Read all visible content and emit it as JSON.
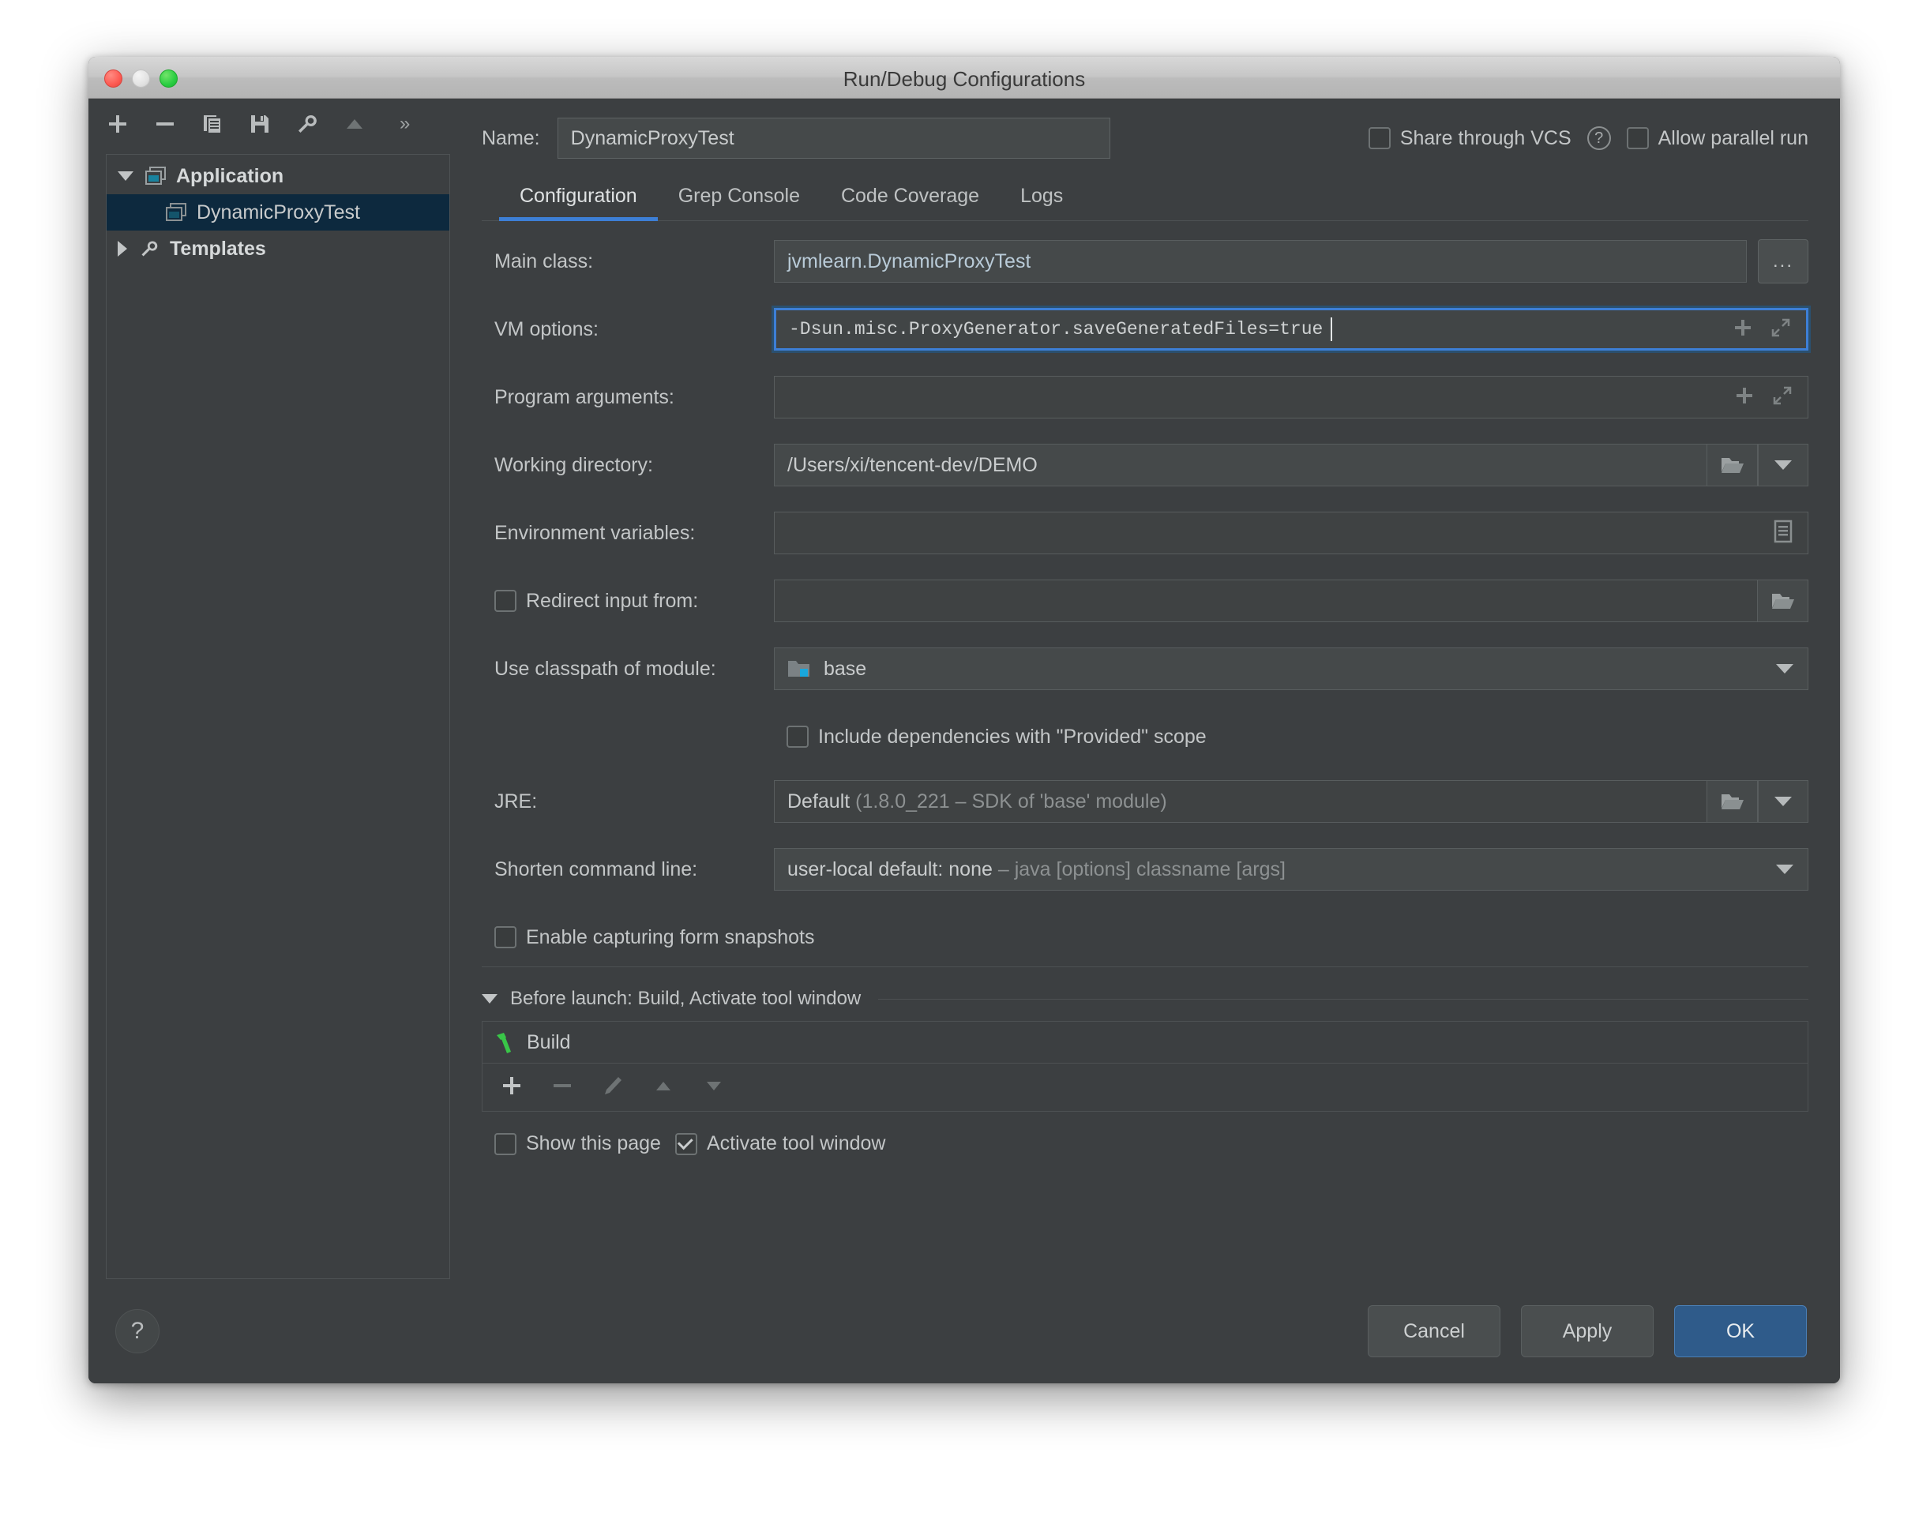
{
  "window": {
    "title": "Run/Debug Configurations"
  },
  "toolbar": {
    "icons": [
      "add-icon",
      "remove-icon",
      "copy-icon",
      "save-icon",
      "wrench-icon",
      "move-up-icon",
      "more-chevrons-icon"
    ]
  },
  "tree": {
    "nodes": [
      {
        "label": "Application",
        "icon": "application-icon",
        "expanded": true,
        "level": 0
      },
      {
        "label": "DynamicProxyTest",
        "icon": "application-icon",
        "selected": true,
        "level": 1
      },
      {
        "label": "Templates",
        "icon": "wrench-icon",
        "expanded": false,
        "level": 0
      }
    ]
  },
  "header": {
    "name_label": "Name:",
    "name_value": "DynamicProxyTest",
    "share_label": "Share through VCS",
    "share_checked": false,
    "allow_parallel_label": "Allow parallel run",
    "allow_parallel_checked": false,
    "help_glyph": "?"
  },
  "tabs": [
    {
      "label": "Configuration",
      "active": true
    },
    {
      "label": "Grep Console",
      "active": false
    },
    {
      "label": "Code Coverage",
      "active": false
    },
    {
      "label": "Logs",
      "active": false
    }
  ],
  "fields": {
    "main_class": {
      "label": "Main class:",
      "value": "jvmlearn.DynamicProxyTest",
      "browse_label": "..."
    },
    "vm_options": {
      "label": "VM options:",
      "value": "-Dsun.misc.ProxyGenerator.saveGeneratedFiles=true ",
      "focused": true
    },
    "program_arguments": {
      "label": "Program arguments:",
      "value": ""
    },
    "working_directory": {
      "label": "Working directory:",
      "value": "/Users/xi/tencent-dev/DEMO"
    },
    "environment_variables": {
      "label": "Environment variables:",
      "value": ""
    },
    "redirect_input": {
      "label": "Redirect input from:",
      "checked": false,
      "value": ""
    },
    "classpath_module": {
      "label": "Use classpath of module:",
      "value": "base"
    },
    "include_provided": {
      "label": "Include dependencies with \"Provided\" scope",
      "checked": false
    },
    "jre": {
      "label": "JRE:",
      "value": "Default",
      "value_detail": "(1.8.0_221 – SDK of 'base' module)"
    },
    "shorten_command_line": {
      "label": "Shorten command line:",
      "value": "user-local default: none",
      "value_detail": "– java [options] classname [args]"
    },
    "form_snapshots": {
      "label": "Enable capturing form snapshots",
      "checked": false
    }
  },
  "before_launch": {
    "header": "Before launch: Build, Activate tool window",
    "items": [
      {
        "label": "Build",
        "icon": "hammer-icon"
      }
    ],
    "toolbar": [
      "add-icon",
      "remove-icon",
      "edit-icon",
      "move-up-icon",
      "move-down-icon"
    ],
    "show_page_label": "Show this page",
    "show_page_checked": false,
    "activate_tool_window_label": "Activate tool window",
    "activate_tool_window_checked": true
  },
  "footer": {
    "help_glyph": "?",
    "cancel": "Cancel",
    "apply": "Apply",
    "ok": "OK"
  },
  "colors": {
    "accent": "#3d7fd6",
    "primary_button": "#2f5b8a",
    "selection": "#0d293e",
    "hammer_green": "#39c648",
    "module_badge": "#19a7dd"
  }
}
